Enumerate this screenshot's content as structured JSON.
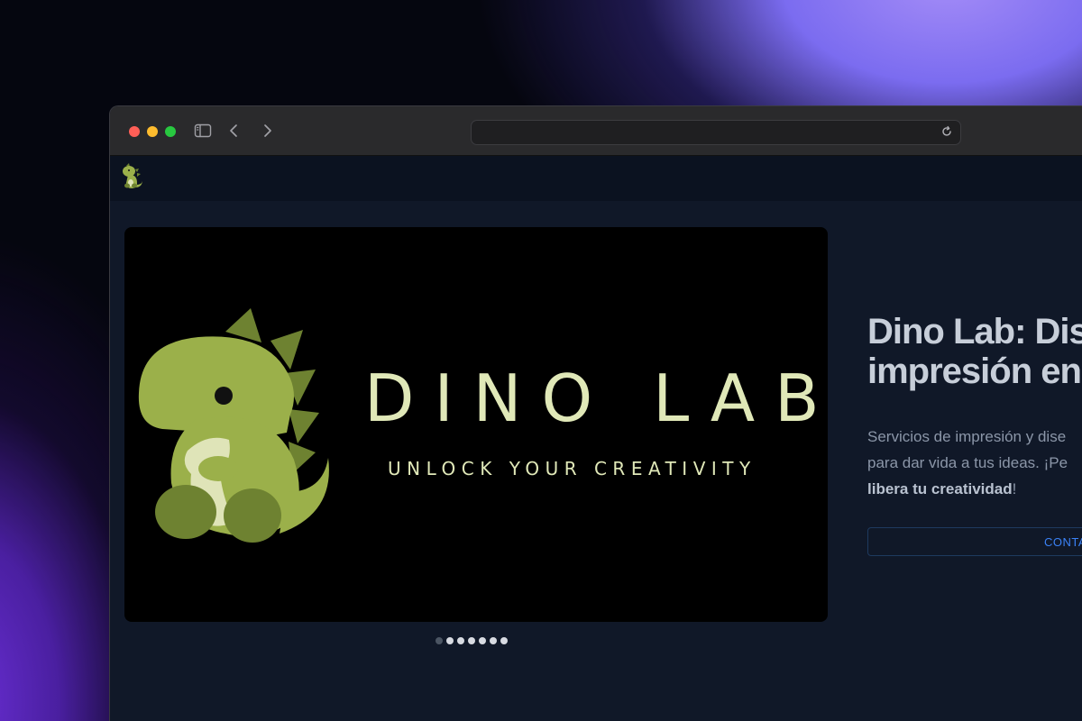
{
  "browser": {
    "url": ""
  },
  "hero": {
    "title": "DINO LAB",
    "tagline": "UNLOCK YOUR CREATIVITY"
  },
  "carousel": {
    "slides": 7,
    "active_index": 0
  },
  "content": {
    "headline_line1": "Dino Lab: Dis",
    "headline_line2": "impresión en",
    "desc_line1": "Servicios de impresión y dise",
    "desc_line2": "para dar vida a tus ideas. ¡Pe",
    "desc_bold": "libera tu creatividad",
    "desc_end": "!",
    "cta_label": "CONTA"
  },
  "colors": {
    "dino_green": "#9bb04a",
    "dino_dark": "#6e8231",
    "dino_light": "#dfe4b8",
    "title_cream": "#e0e8b8",
    "accent_blue": "#3b82f6"
  }
}
